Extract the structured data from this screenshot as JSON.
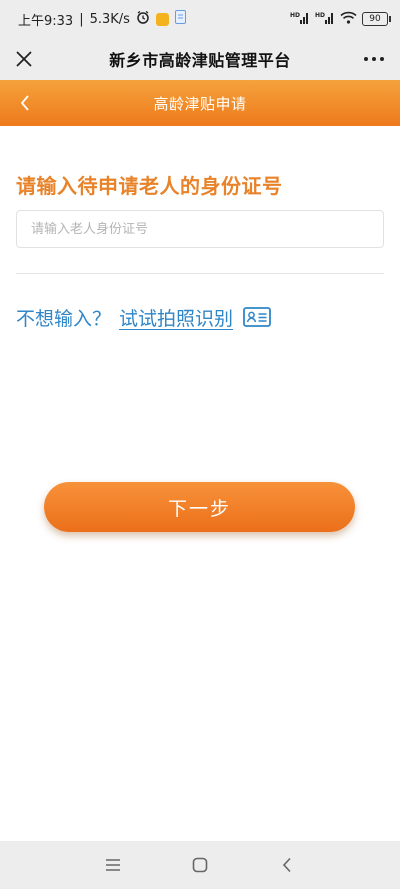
{
  "status_bar": {
    "time": "上午9:33",
    "network_speed": "5.3K/s",
    "battery_level": "90",
    "icons": [
      "alarm-clock-icon",
      "app-notification-icon",
      "file-notification-icon",
      "hd-signal-icon",
      "hd-signal-icon",
      "wifi-icon",
      "battery-icon"
    ]
  },
  "title_bar": {
    "title": "新乡市高龄津贴管理平台",
    "close_icon": "close-icon",
    "more_icon": "more-icon"
  },
  "header": {
    "title": "高龄津贴申请",
    "back_icon": "back-icon",
    "color_top": "#f5a23c",
    "color_bottom": "#ee7a1c"
  },
  "form": {
    "prompt": "请输入待申请老人的身份证号",
    "id_input": {
      "value": "",
      "placeholder": "请输入老人身份证号"
    },
    "alt_prefix": "不想输入？",
    "alt_link": "试试拍照识别",
    "alt_icon": "id-card-icon",
    "next_button": "下一步"
  },
  "colors": {
    "accent": "#e8832a",
    "link": "#2f86c8"
  },
  "nav_bar": {
    "icons": [
      "menu-icon",
      "home-icon",
      "back-icon"
    ]
  }
}
